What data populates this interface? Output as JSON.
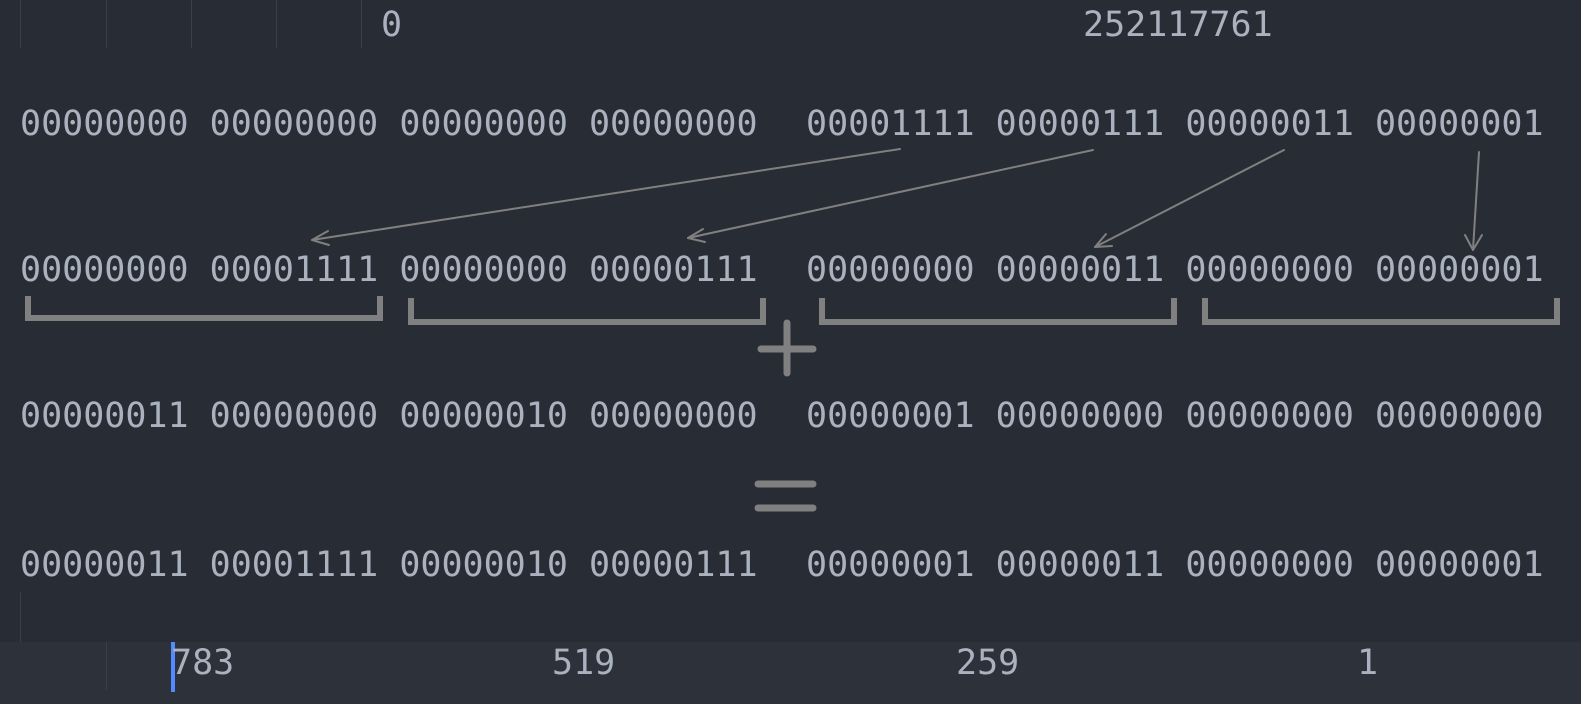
{
  "top_line": {
    "left_value": "0",
    "right_value": "252117761"
  },
  "rows": {
    "source": {
      "left": [
        "00000000",
        "00000000",
        "00000000",
        "00000000"
      ],
      "right": [
        "00001111",
        "00000111",
        "00000011",
        "00000001"
      ]
    },
    "spread": {
      "left": [
        "00000000",
        "00001111",
        "00000000",
        "00000111"
      ],
      "right": [
        "00000000",
        "00000011",
        "00000000",
        "00000001"
      ]
    },
    "addend": {
      "left": [
        "00000011",
        "00000000",
        "00000010",
        "00000000"
      ],
      "right": [
        "00000001",
        "00000000",
        "00000000",
        "00000000"
      ]
    },
    "result": {
      "left": [
        "00000011",
        "00001111",
        "00000010",
        "00000111"
      ],
      "right": [
        "00000001",
        "00000011",
        "00000000",
        "00000001"
      ]
    }
  },
  "operators": {
    "plus": "+",
    "equals": "="
  },
  "bottom_line": {
    "values": [
      "783",
      "519",
      "259",
      "1"
    ]
  },
  "colors": {
    "background": "#282c34",
    "text": "#abb2bf",
    "annotation": "#7f7f7f",
    "cursor": "#528bff",
    "current_line": "#2c313a"
  }
}
